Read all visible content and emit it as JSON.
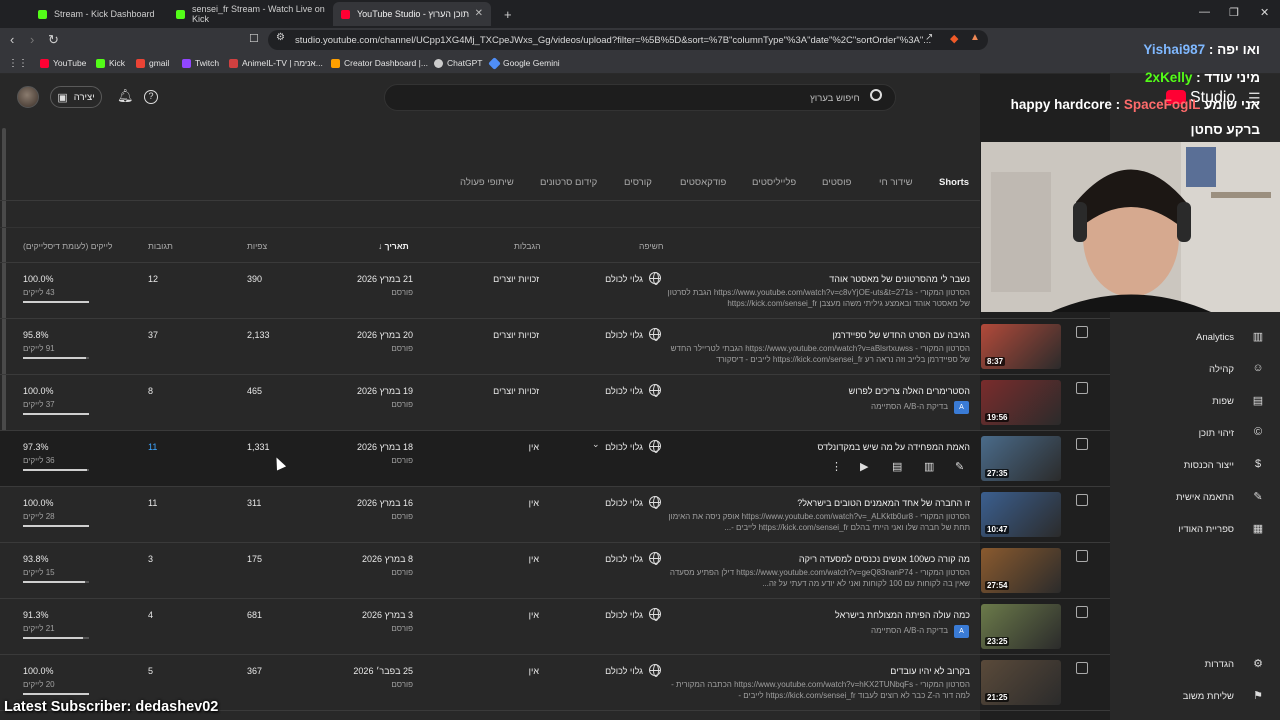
{
  "browser": {
    "tabs": [
      {
        "label": "Stream - Kick Dashboard",
        "icon": "kick-favicon",
        "color": "#53fc18"
      },
      {
        "label": "sensei_fr Stream - Watch Live on Kick",
        "icon": "kick-favicon",
        "color": "#53fc18"
      },
      {
        "label": "YouTube Studio - תוכן הערוץ",
        "icon": "youtube-studio-favicon",
        "color": "#ff0033"
      }
    ],
    "url": "studio.youtube.com/channel/UCpp1XG4Mj_TXCpeJWxs_Gg/videos/upload?filter=%5B%5D&sort=%7B\"columnType\"%3A\"date\"%2C\"sortOrder\"%3A\"...",
    "bookmarks": [
      {
        "label": "YouTube",
        "color": "#ff0033"
      },
      {
        "label": "Kick",
        "color": "#53fc18"
      },
      {
        "label": "gmail",
        "color": "#ea4335"
      },
      {
        "label": "Twitch",
        "color": "#9146ff"
      },
      {
        "label": "AnimeIL-TV | אנימה...",
        "color": "#d04040"
      },
      {
        "label": "Creator Dashboard |...",
        "color": "#ffa000"
      },
      {
        "label": "ChatGPT",
        "color": "#cccccc"
      },
      {
        "label": "Google Gemini",
        "color": "#4f8ef7"
      }
    ]
  },
  "studio": {
    "create_label": "יצירה",
    "search_placeholder": "חיפוש בערוץ",
    "logo_text": "Studio"
  },
  "filter_tabs": [
    "Shorts",
    "שידור חי",
    "פוסטים",
    "פלייליסטים",
    "פודקאסטים",
    "קורסים",
    "קידום סרטונים",
    "שיתופי פעולה"
  ],
  "columns": {
    "visibility": "חשיפה",
    "restrictions": "הגבלות",
    "date": "תאריך",
    "views": "צפיות",
    "comments": "תגובות",
    "likes": "לייקים (לעומת דיסלייקים)"
  },
  "rows": [
    {
      "title": "נשבר לי מהסרטונים של מאסטר אוהד",
      "desc": "הסרטון המקורי - https://www.youtube.com/watch?v=c8vYjOE-uts&t=271s הגבת לסרטון של מאסטר אוהד ובאמצע גיליתי משהו מעצבן https://kick.com/sensei_fr",
      "ab": "",
      "visibility": "גלוי לכולם",
      "restrictions": "זכויות יוצרים",
      "date": "21 במרץ 2026",
      "status": "פורסם",
      "views": "390",
      "comments": "12",
      "likes_pct": "100.0%",
      "likes_count": "43 לייקים",
      "likes_frac": 1.0,
      "duration": "",
      "thumb_color": "#555"
    },
    {
      "title": "הגיבה עם הסרט החדש של ספיידרמן",
      "desc": "הסרטון המקורי - https://www.youtube.com/watch?v=aBlsrtxuwss הגבתי לטריילר החדש של ספיידרמן בלייב וזה נראה רע https://kick.com/sensei_fr לייבים - דיסקורד",
      "ab": "",
      "visibility": "גלוי לכולם",
      "restrictions": "זכויות יוצרים",
      "date": "20 במרץ 2026",
      "status": "פורסם",
      "views": "2,133",
      "comments": "37",
      "likes_pct": "95.8%",
      "likes_count": "91 לייקים",
      "likes_frac": 0.958,
      "duration": "8:37",
      "thumb_color": "#b24a3a"
    },
    {
      "title": "הסטרימרים האלה צריכים לפרוש",
      "desc": "",
      "ab": "בדיקת ה-A/B הסתיימה",
      "visibility": "גלוי לכולם",
      "restrictions": "זכויות יוצרים",
      "date": "19 במרץ 2026",
      "status": "פורסם",
      "views": "465",
      "comments": "8",
      "likes_pct": "100.0%",
      "likes_count": "37 לייקים",
      "likes_frac": 1.0,
      "duration": "19:56",
      "thumb_color": "#7a2c2c"
    },
    {
      "title": "האמת המפחידה על מה שיש במקדונלדס",
      "desc": "",
      "ab": "",
      "visibility": "גלוי לכולם",
      "restrictions": "אין",
      "date": "18 במרץ 2026",
      "status": "פורסם",
      "views": "1,331",
      "comments": "11",
      "likes_pct": "97.3%",
      "likes_count": "36 לייקים",
      "likes_frac": 0.973,
      "duration": "27:35",
      "thumb_color": "#4a6b8a"
    },
    {
      "title": "זו החברה של אחד המאמנים הטובים בישראל?",
      "desc": "הסרטון המקורי - https://www.youtube.com/watch?v=_ALKktb0ur8 אופק ניסה את האימון תחת של חברה שלו ואני הייתי בהלם https://kick.com/sensei_fr לייבים -...",
      "ab": "",
      "visibility": "גלוי לכולם",
      "restrictions": "אין",
      "date": "16 במרץ 2026",
      "status": "פורסם",
      "views": "311",
      "comments": "11",
      "likes_pct": "100.0%",
      "likes_count": "28 לייקים",
      "likes_frac": 1.0,
      "duration": "10:47",
      "thumb_color": "#3b5f8f"
    },
    {
      "title": "מה קורה כש100 אנשים נכנסים למסעדה ריקה",
      "desc": "הסרטון המקורי - https://www.youtube.com/watch?v=geQ83nanP74 דילן הפתיע מסעדה שאין בה לקוחות עם 100 לקוחות ואני לא יודע מה דעתי על זה...",
      "ab": "",
      "visibility": "גלוי לכולם",
      "restrictions": "אין",
      "date": "8 במרץ 2026",
      "status": "פורסם",
      "views": "175",
      "comments": "3",
      "likes_pct": "93.8%",
      "likes_count": "15 לייקים",
      "likes_frac": 0.938,
      "duration": "27:54",
      "thumb_color": "#8a5a2e"
    },
    {
      "title": "כמה עולה הפיתה המצולחת בישראל",
      "desc": "",
      "ab": "בדיקת ה-A/B הסתיימה",
      "visibility": "גלוי לכולם",
      "restrictions": "אין",
      "date": "3 במרץ 2026",
      "status": "פורסם",
      "views": "681",
      "comments": "4",
      "likes_pct": "91.3%",
      "likes_count": "21 לייקים",
      "likes_frac": 0.913,
      "duration": "23:25",
      "thumb_color": "#6b7a4a"
    },
    {
      "title": "בקרוב לא יהיו עובדים",
      "desc": "הסרטון המקורי - https://www.youtube.com/watch?v=hKX2TUNbqFs הכתבה המקורית - למה דור ה-Z כבר לא רוצים לעבוד https://kick.com/sensei_fr לייבים -",
      "ab": "",
      "visibility": "גלוי לכולם",
      "restrictions": "אין",
      "date": "25 בפבר׳ 2026",
      "status": "פורסם",
      "views": "367",
      "comments": "5",
      "likes_pct": "100.0%",
      "likes_count": "20 לייקים",
      "likes_frac": 1.0,
      "duration": "21:25",
      "thumb_color": "#5a4a3a"
    }
  ],
  "sidebar": {
    "items": [
      {
        "label": "Analytics",
        "icon": "analytics-icon"
      },
      {
        "label": "קהילה",
        "icon": "community-icon"
      },
      {
        "label": "שפות",
        "icon": "subtitles-icon"
      },
      {
        "label": "זיהוי תוכן",
        "icon": "copyright-icon"
      },
      {
        "label": "ייצור הכנסות",
        "icon": "monetization-icon"
      },
      {
        "label": "התאמה אישית",
        "icon": "customization-icon"
      },
      {
        "label": "ספריית האודיו",
        "icon": "audio-library-icon"
      }
    ],
    "bottom_items": [
      {
        "label": "הגדרות",
        "icon": "settings-icon"
      },
      {
        "label": "שליחת משוב",
        "icon": "feedback-icon"
      }
    ]
  },
  "overlay": {
    "chat": [
      {
        "user": "Yishai987",
        "msg": "ואו יפה",
        "color": "#7fb8ff"
      },
      {
        "user": "2xKelly",
        "msg": "מיני עודד",
        "color": "#53fc18"
      },
      {
        "user": "SpaceFogIL",
        "msg": "אני שומע happy hardcore",
        "color": "#ff6b6b"
      },
      {
        "user": "",
        "msg": "ברקע סחטן",
        "color": "#ffffff"
      }
    ],
    "latest_subscriber": "Latest Subscriber: dedashev02"
  }
}
